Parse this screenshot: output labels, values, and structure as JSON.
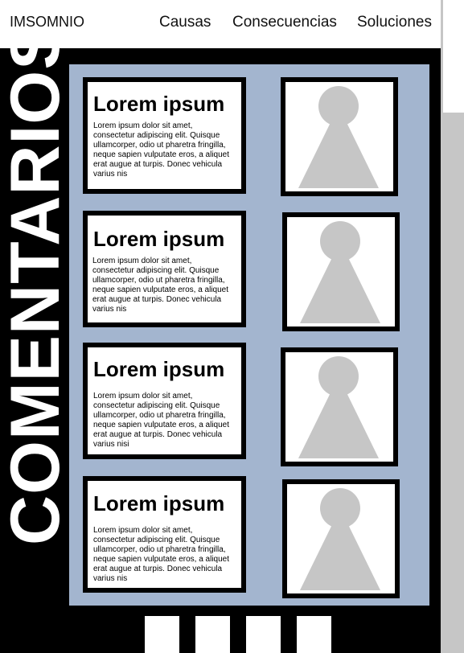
{
  "header": {
    "brand": "IMSOMNIO",
    "nav": [
      "Causas",
      "Consecuencias",
      "Soluciones"
    ]
  },
  "section_title": "COMENTARIOS",
  "cards": [
    {
      "title": "Lorem ipsum",
      "body": "Lorem ipsum dolor sit amet, consectetur adipiscing elit. Quisque ullamcorper, odio ut pharetra fringilla, neque sapien vulputate eros, a aliquet erat augue at turpis. Donec vehicula varius nis"
    },
    {
      "title": "Lorem ipsum",
      "body": "Lorem ipsum dolor sit amet, consectetur adipiscing elit. Quisque ullamcorper, odio ut pharetra fringilla, neque sapien vulputate eros, a aliquet erat augue at turpis. Donec vehicula varius nis"
    },
    {
      "title": "Lorem ipsum",
      "body": "Lorem ipsum dolor sit amet, consectetur adipiscing elit. Quisque ullamcorper, odio ut pharetra fringilla, neque sapien vulputate eros, a aliquet erat augue at turpis. Donec vehicula varius nisi"
    },
    {
      "title": "Lorem ipsum",
      "body": "Lorem ipsum dolor sit amet, consectetur adipiscing elit. Quisque ullamcorper, odio ut pharetra fringilla, neque sapien vulputate eros, a aliquet erat augue at turpis. Donec vehicula varius nis"
    }
  ],
  "avatar_icon": "person-placeholder-icon",
  "colors": {
    "panel": "#a3b5cf",
    "stage": "#000000",
    "avatar": "#c6c6c6",
    "scrollbar": "#c6c6c6"
  },
  "pagination_count": 4
}
